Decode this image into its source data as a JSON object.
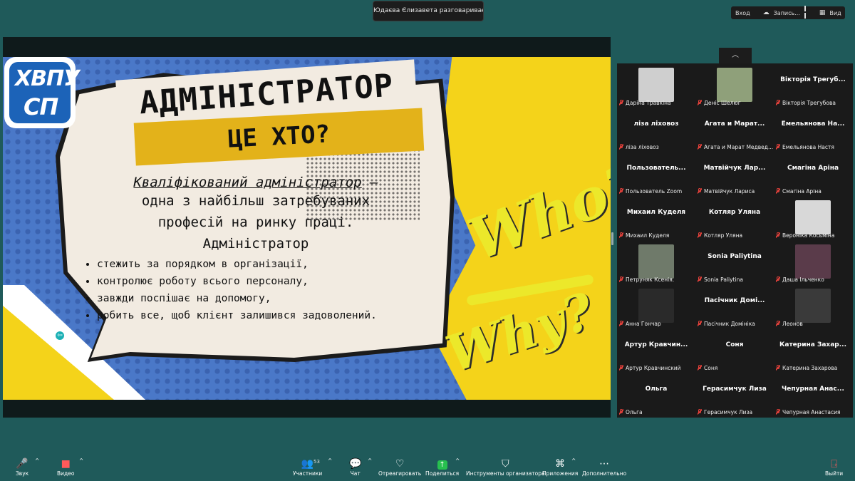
{
  "top": {
    "speaking_banner": "Юдаєва Єлизавета разговаривает...",
    "enter_label": "Вход",
    "record_label": "Запись...",
    "view_label": "Вид"
  },
  "slide": {
    "logo_line1": "ХВПУ",
    "logo_line2": "СП",
    "title": "АДМІНІСТРАТОР",
    "subtitle": "ЦЕ ХТО?",
    "lead_em": "Кваліфікований адміністратор",
    "lead_rest": " –",
    "line2": "одна з найбільш затребуваних",
    "line3": "професій на ринку праці.",
    "line4": "Адміністратор",
    "bullets": [
      "стежить за порядком в організації,",
      "контролює роботу всього персоналу,",
      "завжди поспішає на допомогу,",
      "робить все, щоб клієнт залишився задоволений."
    ],
    "who": "Who?",
    "why": "Why?"
  },
  "gallery": {
    "collapse_icon": "chevron-up-icon",
    "participants": [
      {
        "display": "",
        "label": "Даріна Травкіна",
        "avatar": "#cfcfcf"
      },
      {
        "display": "",
        "label": "Деніс Шелюг",
        "avatar": "#8fa07a"
      },
      {
        "display": "Вікторія Трегуб...",
        "label": "Вікторія Трегубова"
      },
      {
        "display": "ліза ліховоз",
        "label": "ліза ліховоз"
      },
      {
        "display": "Агата и Марат...",
        "label": "Агата и Марат Медвед..."
      },
      {
        "display": "Емельянова На...",
        "label": "Емельянова Настя"
      },
      {
        "display": "Пользователь...",
        "label": "Пользователь Zoom"
      },
      {
        "display": "Матвійчук Лар...",
        "label": "Матвійчук Лариса"
      },
      {
        "display": "Смагіна Аріна",
        "label": "Смагіна Аріна"
      },
      {
        "display": "Михаил Куделя",
        "label": "Михаил Куделя"
      },
      {
        "display": "Котляр Уляна",
        "label": "Котляр Уляна"
      },
      {
        "display": "",
        "label": "Вероніка Косьміна",
        "avatar": "#d8d8d8"
      },
      {
        "display": "",
        "label": "Петруняк Ксенія.",
        "avatar": "#6f7a6a"
      },
      {
        "display": "Sonia Paliytina",
        "label": "Sonia Paliytina"
      },
      {
        "display": "",
        "label": "Даша Ільченко",
        "avatar": "#5a3b4a"
      },
      {
        "display": "",
        "label": "Анна Гончар",
        "avatar": "#2a2a2a"
      },
      {
        "display": "Пасічник Домі...",
        "label": "Пасічник Домініка"
      },
      {
        "display": "",
        "label": "Леонов",
        "avatar": "#3a3a3a"
      },
      {
        "display": "Артур Кравчин...",
        "label": "Артур Кравчинский"
      },
      {
        "display": "Соня",
        "label": "Соня"
      },
      {
        "display": "Катерина Захар...",
        "label": "Катерина Захарова"
      },
      {
        "display": "Ольга",
        "label": "Ольга"
      },
      {
        "display": "Герасимчук Лиза",
        "label": "Герасимчук Лиза"
      },
      {
        "display": "Чепурная Анас...",
        "label": "Чепурная Анастасия"
      }
    ]
  },
  "toolbar": {
    "audio": "Звук",
    "video": "Видео",
    "participants": "Участники",
    "participants_count": "53",
    "chat": "Чат",
    "react": "Отреагировать",
    "share": "Поделиться",
    "host_tools": "Инструменты организатора",
    "apps": "Приложения",
    "more": "Дополнительно",
    "leave": "Выйти"
  }
}
